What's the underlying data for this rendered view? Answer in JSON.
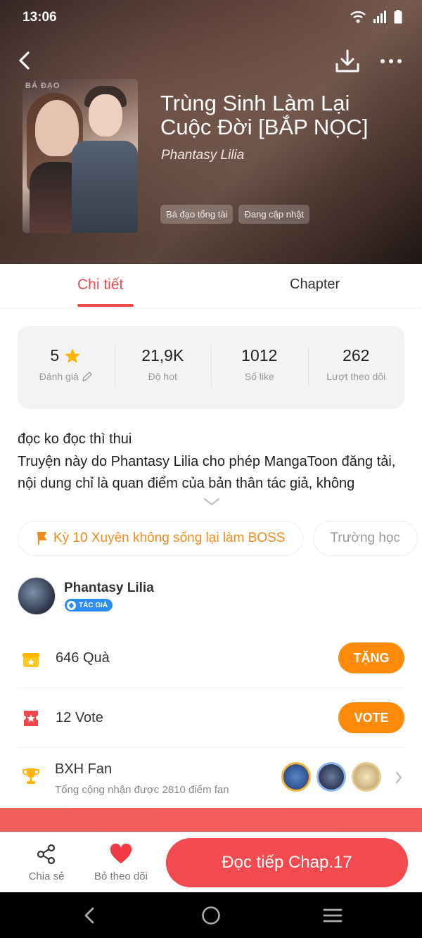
{
  "status": {
    "time": "13:06"
  },
  "book": {
    "title": "Trùng Sinh Làm Lại Cuộc Đời [BẮP NỌC]",
    "author": "Phantasy Lilia",
    "cover_mark": "BÁ ĐẠO",
    "tags": [
      "Bá đạo tổng tài",
      "Đang cập nhật"
    ]
  },
  "tabs": {
    "detail": "Chi tiết",
    "chapter": "Chapter"
  },
  "stats": [
    {
      "value": "5",
      "label": "Đánh giá"
    },
    {
      "value": "21,9K",
      "label": "Độ hot"
    },
    {
      "value": "1012",
      "label": "Số like"
    },
    {
      "value": "262",
      "label": "Lượt theo dõi"
    }
  ],
  "description": {
    "line1": "đọc ko đọc thì thui",
    "line2": "Truyện này do Phantasy Lilia cho phép MangaToon đăng tải, nội dung chỉ là quan điểm của bản thân tác giả, không"
  },
  "chips": {
    "event": "Kỳ 10 Xuyên không sống lại làm BOSS",
    "school": "Trường học"
  },
  "author": {
    "name": "Phantasy Lilia",
    "badge": "TÁC GIẢ"
  },
  "gift": {
    "count": "646",
    "unit": "Quà",
    "button": "TẶNG"
  },
  "vote": {
    "count": "12",
    "unit": "Vote",
    "button": "VOTE"
  },
  "fan": {
    "title": "BXH Fan",
    "subtitle": "Tổng cộng nhận được 2810 điểm fan"
  },
  "bottom": {
    "share": "Chia sẻ",
    "unfollow": "Bỏ theo dõi",
    "read": "Đọc tiếp Chap.17"
  },
  "colors": {
    "accent": "#ee4b4b",
    "orange": "#ff8a0a",
    "read_button": "#f24a4f"
  },
  "icons": [
    "back-arrow-icon",
    "download-icon",
    "more-icon",
    "star-icon",
    "edit-icon",
    "chevron-down-icon",
    "flag-icon",
    "gift-icon",
    "ticket-icon",
    "trophy-icon",
    "chevron-right-icon",
    "share-icon",
    "heart-icon",
    "nav-back-icon",
    "nav-home-icon",
    "nav-recents-icon"
  ]
}
